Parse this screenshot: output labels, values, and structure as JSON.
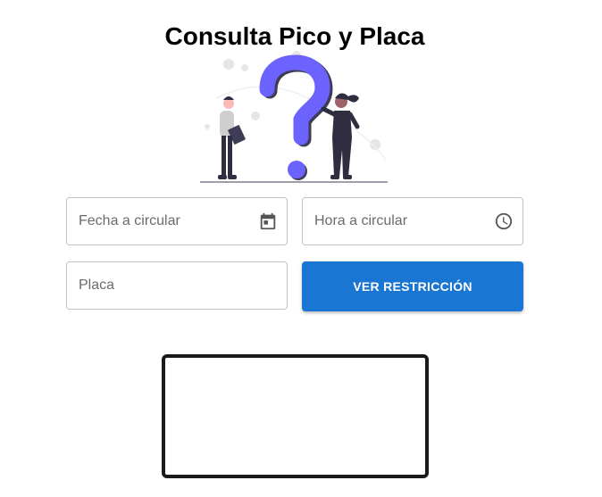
{
  "page": {
    "title": "Consulta Pico y Placa"
  },
  "form": {
    "date_field": {
      "placeholder": "Fecha a circular",
      "icon": "calendar-icon"
    },
    "time_field": {
      "placeholder": "Hora a circular",
      "icon": "clock-icon"
    },
    "plate_field": {
      "placeholder": "Placa"
    },
    "submit_label": "VER RESTRICCIÓN"
  },
  "colors": {
    "accent": "#1976d2",
    "illustration_accent": "#6c63ff",
    "border": "#c4c4c4"
  }
}
